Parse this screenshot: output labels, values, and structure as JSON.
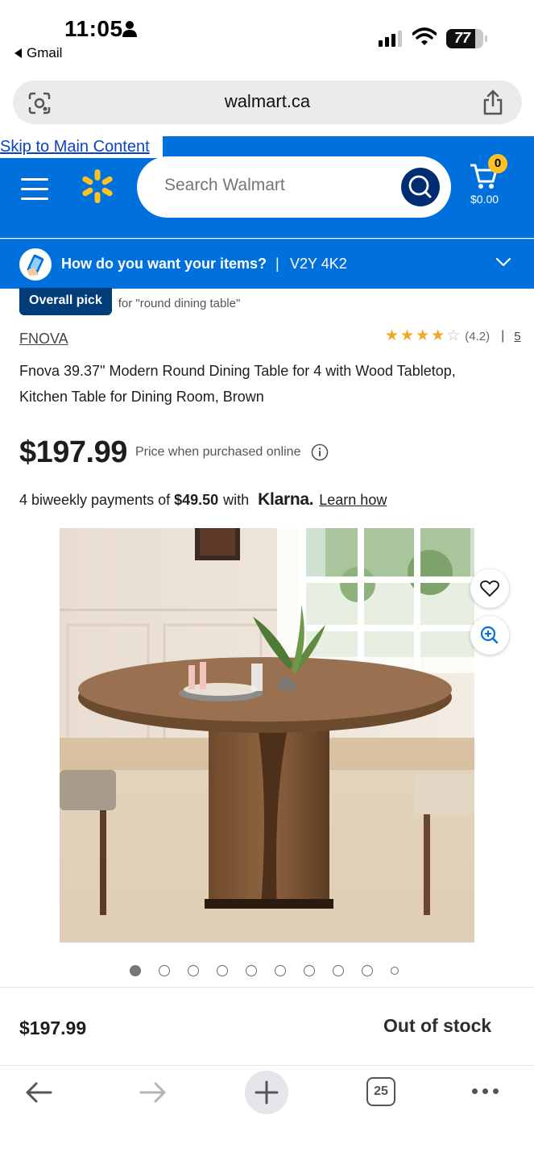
{
  "status": {
    "time": "11:05",
    "back_app": "Gmail",
    "battery": "77"
  },
  "browser": {
    "url": "walmart.ca",
    "tabs_count": "25"
  },
  "header": {
    "skip_link": "Skip to Main Content",
    "search_placeholder": "Search Walmart",
    "cart_count": "0",
    "cart_total": "$0.00",
    "brand_color": "#0071dc",
    "spark_color": "#ffc220"
  },
  "delivery": {
    "question": "How do you want your items?",
    "separator": "|",
    "postal_code": "V2Y 4K2"
  },
  "product": {
    "badge": "Overall pick",
    "badge_context": "for \"round dining table\"",
    "brand": "FNOVA",
    "rating_value": 4.2,
    "rating_text": "(4.2)",
    "rating_separator": "|",
    "review_count": "5",
    "title": "Fnova 39.37\" Modern Round Dining Table for 4 with Wood Tabletop, Kitchen Table for Dining Room, Brown",
    "price": "$197.99",
    "price_note": "Price when purchased online",
    "klarna": {
      "prefix": "4 biweekly payments of",
      "amount": "$49.50",
      "with": "with",
      "logo": "Klarna.",
      "link": "Learn how"
    },
    "image_count": 10,
    "active_image": 0
  },
  "sticky_bar": {
    "price": "$197.99",
    "availability": "Out of stock"
  }
}
